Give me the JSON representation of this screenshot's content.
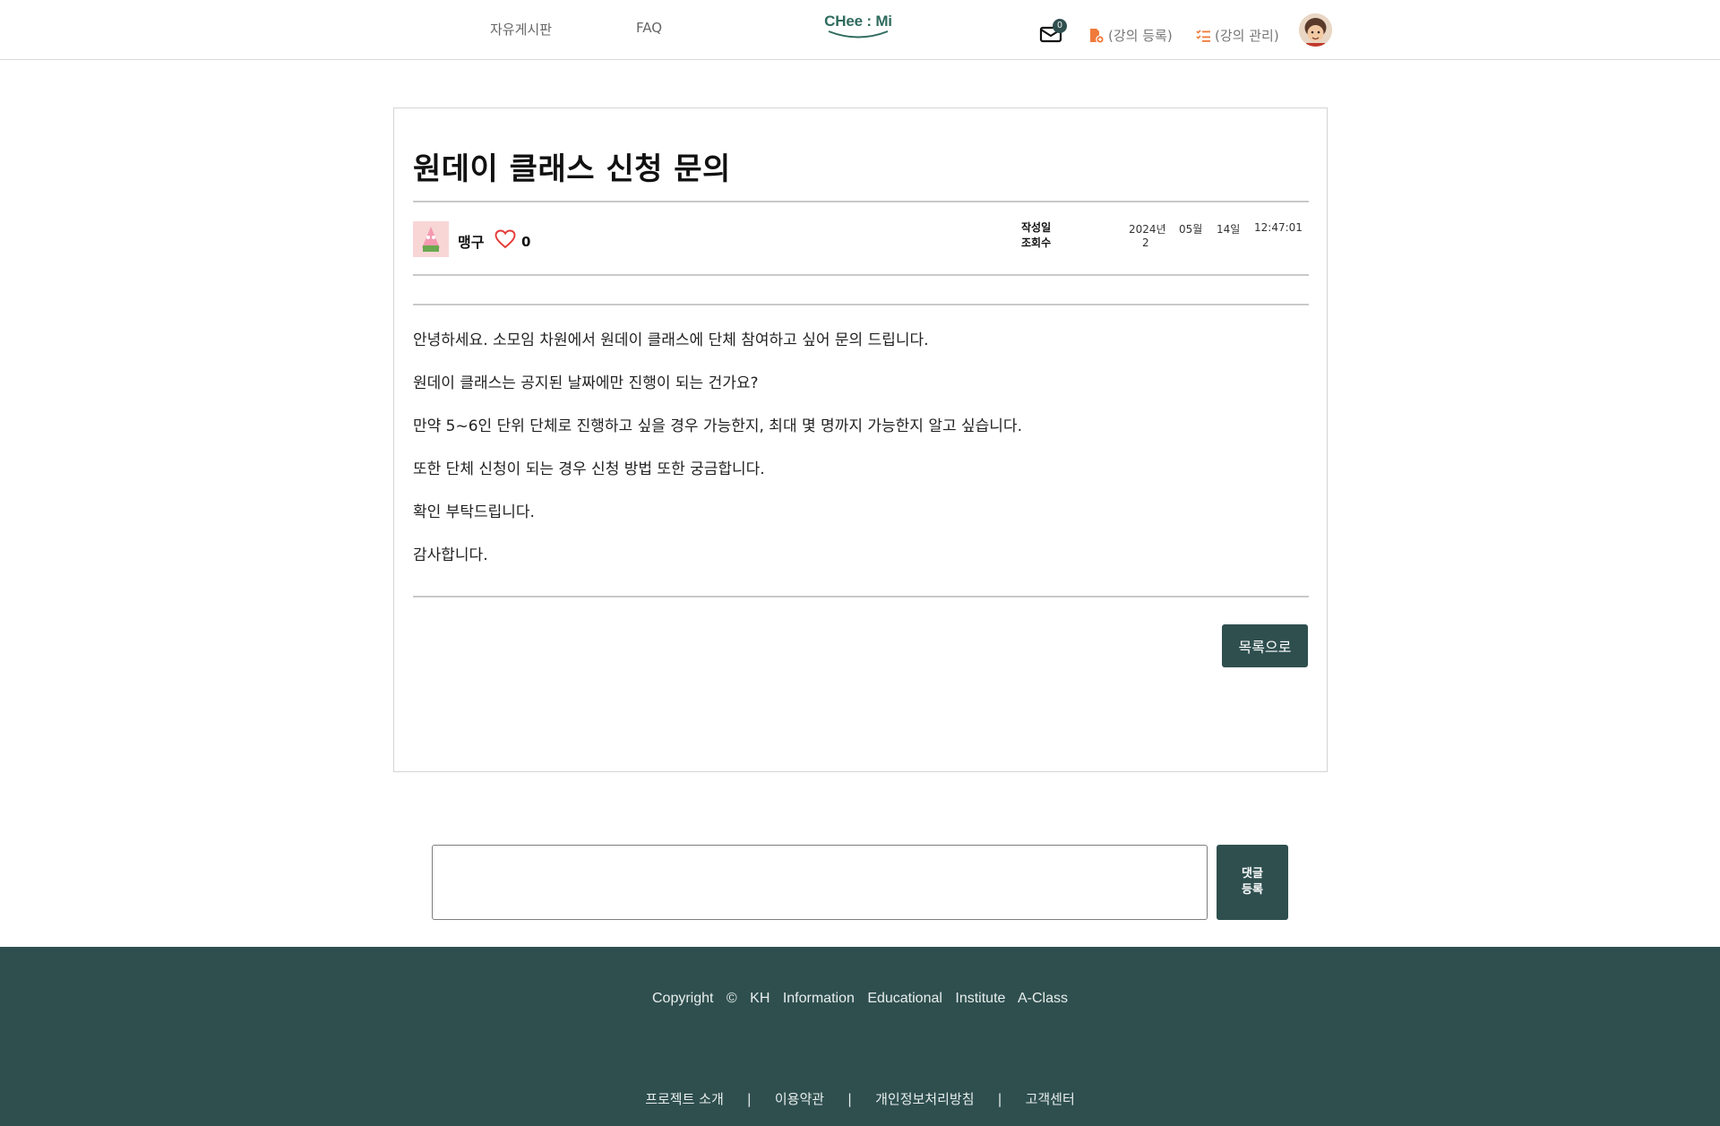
{
  "header": {
    "nav_board": "자유게시판",
    "nav_faq": "FAQ",
    "logo_text": "CHee : Mi",
    "mail_count": "0",
    "register_label": "(강의 등록)",
    "manage_label": "(강의 관리)"
  },
  "post": {
    "title": "원데이 클래스 신청 문의",
    "author": "맹구",
    "likes": "0",
    "date_label": "작성일",
    "views_label": "조회수",
    "date_year": "2024년",
    "date_month": "05월",
    "date_day": "14일",
    "date_time": "12:47:01",
    "views": "2",
    "body": [
      "안녕하세요. 소모임 차원에서 원데이 클래스에 단체 참여하고 싶어 문의 드립니다.",
      "원데이 클래스는 공지된 날짜에만 진행이 되는 건가요?",
      "만약 5~6인 단위 단체로 진행하고 싶을 경우 가능한지, 최대 몇 명까지 가능한지 알고 싶습니다.",
      "또한 단체 신청이 되는 경우 신청 방법 또한 궁금합니다.",
      "확인 부탁드립니다.",
      "감사합니다."
    ],
    "list_button": "목록으로"
  },
  "comment": {
    "submit_label": "댓글\n등록"
  },
  "footer": {
    "copyright": "Copyright © KH Information Educational Institute A-Class",
    "links": [
      "프로젝트 소개",
      "이용약관",
      "개인정보처리방침",
      "고객센터"
    ]
  },
  "colors": {
    "brand_dark": "#2f4f4f",
    "logo_green": "#2f6b5e",
    "accent_orange": "#f07a3a",
    "like_red": "#e53935"
  }
}
